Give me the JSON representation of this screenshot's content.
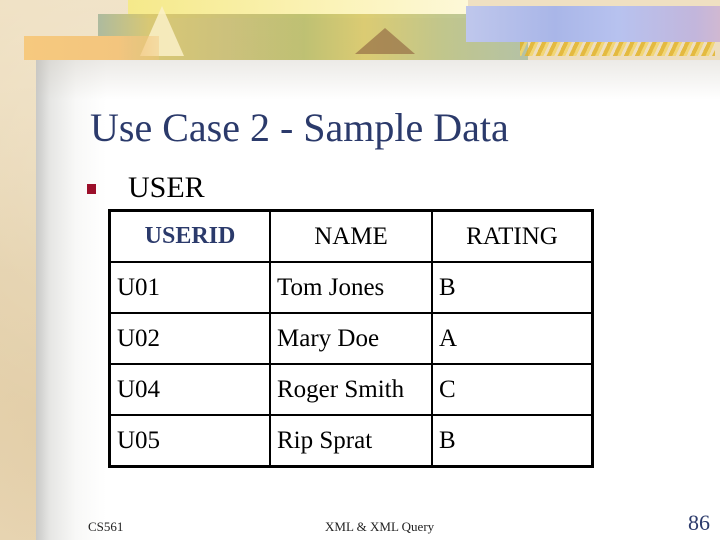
{
  "slide": {
    "title": "Use Case 2 - Sample Data",
    "bullet": "USER",
    "colors": {
      "title": "#2b3a6b",
      "bullet": "#9b0f2a",
      "key_header": "#2b3a6b"
    }
  },
  "table": {
    "columns": [
      "USERID",
      "NAME",
      "RATING"
    ],
    "rows": [
      [
        "U01",
        "Tom Jones",
        "B"
      ],
      [
        "U02",
        "Mary Doe",
        "A"
      ],
      [
        "U04",
        "Roger Smith",
        "C"
      ],
      [
        "U05",
        "Rip Sprat",
        "B"
      ]
    ]
  },
  "footer": {
    "left": "CS561",
    "center": "XML & XML Query",
    "page_number": "86"
  }
}
